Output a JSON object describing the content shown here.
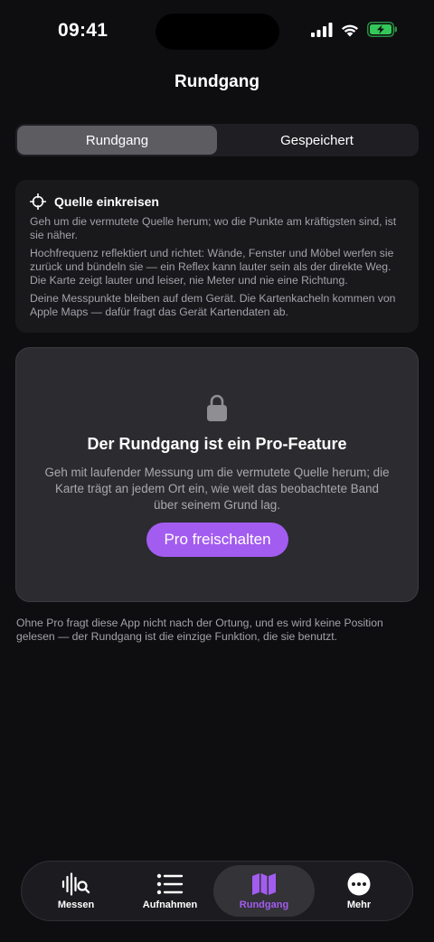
{
  "status_bar": {
    "time": "09:41"
  },
  "nav": {
    "title": "Rundgang"
  },
  "segmented": {
    "items": [
      "Rundgang",
      "Gespeichert"
    ],
    "selected": "Rundgang"
  },
  "info": {
    "title": "Quelle einkreisen",
    "paragraphs": [
      "Geh um die vermutete Quelle herum; wo die Punkte am kräftigsten sind, ist sie näher.",
      "Hochfrequenz reflektiert und richtet: Wände, Fenster und Möbel werfen sie zurück und bündeln sie — ein Reflex kann lauter sein als der direkte Weg. Die Karte zeigt lauter und leiser, nie Meter und nie eine Richtung.",
      "Deine Messpunkte bleiben auf dem Gerät. Die Kartenkacheln kommen von Apple Maps — dafür fragt das Gerät Kartendaten ab."
    ]
  },
  "pro": {
    "title": "Der Rundgang ist ein Pro-Feature",
    "description": "Geh mit laufender Messung um die vermutete Quelle herum; die Karte trägt an jedem Ort ein, wie weit das beobachtete Band über seinem Grund lag.",
    "button": "Pro freischalten"
  },
  "footnote": "Ohne Pro fragt diese App nicht nach der Ortung, und es wird keine Position gelesen — der Rundgang ist die einzige Funktion, die sie benutzt.",
  "tabs": [
    {
      "label": "Messen",
      "icon": "waveform-search-icon"
    },
    {
      "label": "Aufnahmen",
      "icon": "list-icon"
    },
    {
      "label": "Rundgang",
      "icon": "map-icon"
    },
    {
      "label": "Mehr",
      "icon": "more-icon"
    }
  ],
  "active_tab": "Rundgang",
  "colors": {
    "accent": "#a35cf0",
    "background": "#0e0e11",
    "card": "#2c2c30",
    "battery": "#34c759"
  }
}
